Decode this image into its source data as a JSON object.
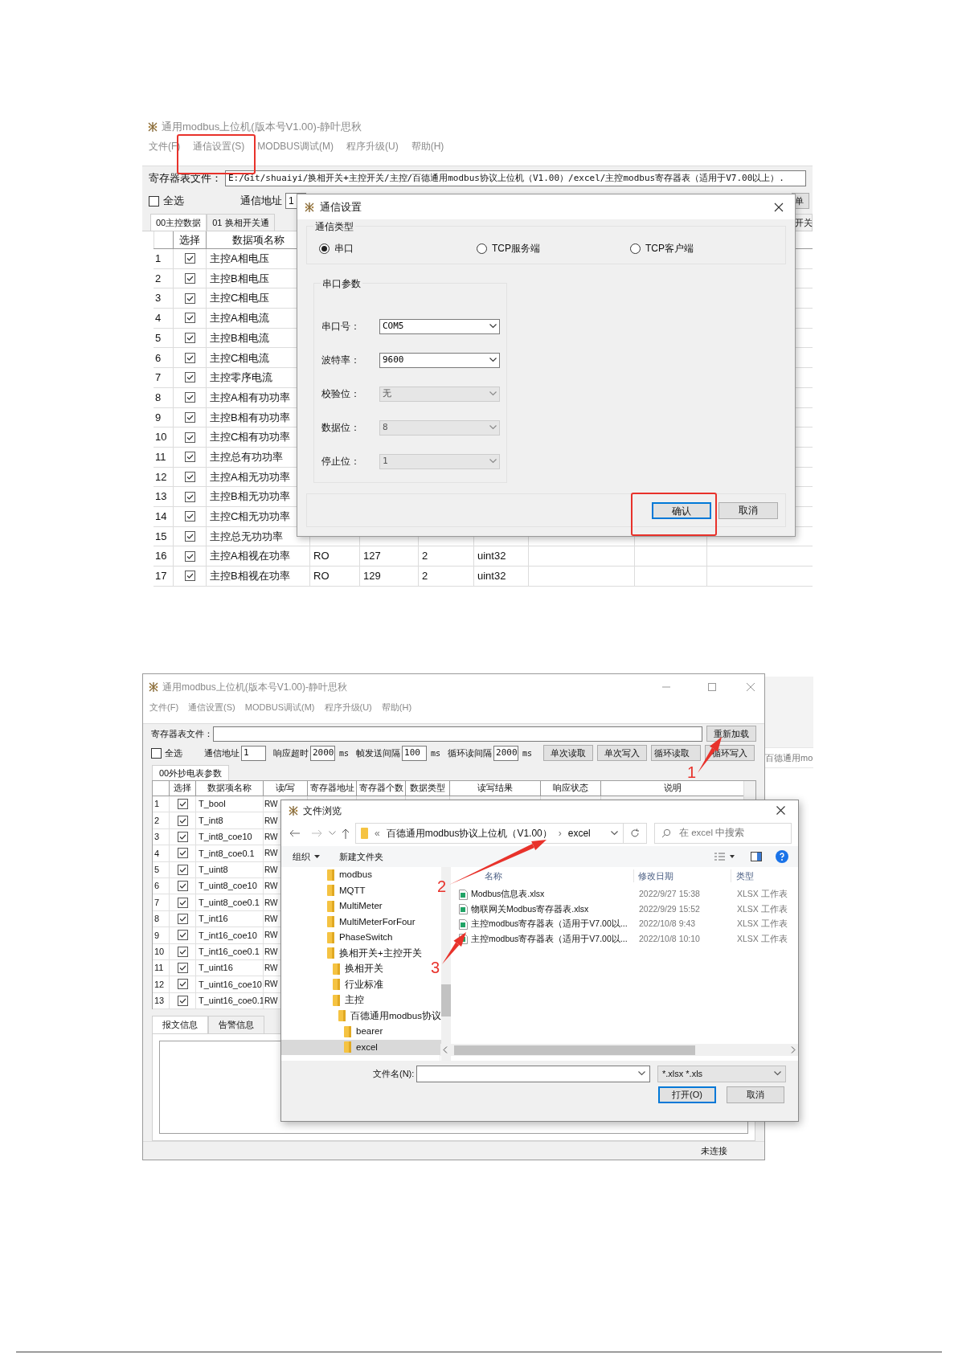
{
  "settings_view": {
    "window": {
      "title": "通用modbus上位机(版本号V1.00)-静叶思秋"
    },
    "menu": [
      "文件(F)",
      "通信设置(S)",
      "MODBUS调试(M)",
      "程序升级(U)",
      "帮助(H)"
    ],
    "register_file": {
      "label": "寄存器表文件：",
      "value": "E:/Git/shuaiyi/换相开关+主控开关/主控/百德通用modbus协议上位机（V1.00）/excel/主控modbus寄存器表（适用于V7.00以上）."
    },
    "select_all": {
      "label": "全选",
      "checked": false
    },
    "address": {
      "label": "通信地址",
      "value": "1"
    },
    "edge_button": "单",
    "tabs": [
      {
        "label": "00主控数据",
        "selected": true
      },
      {
        "label": "01 换相开关通",
        "selected": false
      },
      {
        "label": "开关",
        "selected": false
      }
    ],
    "table": {
      "columns": [
        "选择",
        "数据项名称"
      ],
      "rows": [
        {
          "index": "1",
          "checked": true,
          "name": "主控A相电压"
        },
        {
          "index": "2",
          "checked": true,
          "name": "主控B相电压"
        },
        {
          "index": "3",
          "checked": true,
          "name": "主控C相电压"
        },
        {
          "index": "4",
          "checked": true,
          "name": "主控A相电流"
        },
        {
          "index": "5",
          "checked": true,
          "name": "主控B相电流"
        },
        {
          "index": "6",
          "checked": true,
          "name": "主控C相电流"
        },
        {
          "index": "7",
          "checked": true,
          "name": "主控零序电流"
        },
        {
          "index": "8",
          "checked": true,
          "name": "主控A相有功功率"
        },
        {
          "index": "9",
          "checked": true,
          "name": "主控B相有功功率"
        },
        {
          "index": "10",
          "checked": true,
          "name": "主控C相有功功率"
        },
        {
          "index": "11",
          "checked": true,
          "name": "主控总有功功率"
        },
        {
          "index": "12",
          "checked": true,
          "name": "主控A相无功功率"
        },
        {
          "index": "13",
          "checked": true,
          "name": "主控B相无功功率"
        },
        {
          "index": "14",
          "checked": true,
          "name": "主控C相无功功率"
        },
        {
          "index": "15",
          "checked": true,
          "name": "主控总无功功率"
        },
        {
          "index": "16",
          "checked": true,
          "name": "主控A相视在功率",
          "cells": [
            "RO",
            "127",
            "2",
            "uint32"
          ]
        },
        {
          "index": "17",
          "checked": true,
          "name": "主控B相视在功率",
          "cells": [
            "RO",
            "129",
            "2",
            "uint32"
          ]
        }
      ]
    },
    "dialog": {
      "title": "通信设置",
      "type_group": {
        "title": "通信类型",
        "options": [
          {
            "label": "串口",
            "selected": true
          },
          {
            "label": "TCP服务端",
            "selected": false
          },
          {
            "label": "TCP客户端",
            "selected": false
          }
        ]
      },
      "serial_group": {
        "title": "串口参数",
        "fields": [
          {
            "label": "串口号：",
            "value": "COM5",
            "disabled": false
          },
          {
            "label": "波特率：",
            "value": "9600",
            "disabled": false
          },
          {
            "label": "校验位：",
            "value": "无",
            "disabled": true
          },
          {
            "label": "数据位：",
            "value": "8",
            "disabled": true
          },
          {
            "label": "停止位：",
            "value": "1",
            "disabled": true
          }
        ]
      },
      "buttons": [
        {
          "label": "确认",
          "default": true
        },
        {
          "label": "取消",
          "default": false
        }
      ]
    }
  },
  "file_view": {
    "window": {
      "title": "通用modbus上位机(版本号V1.00)-静叶思秋"
    },
    "menu": [
      "文件(F)",
      "通信设置(S)",
      "MODBUS调试(M)",
      "程序升级(U)",
      "帮助(H)"
    ],
    "register_file": {
      "label": "寄存器表文件："
    },
    "reload_button": "重新加载",
    "select_all": {
      "label": "全选",
      "checked": false
    },
    "params": [
      {
        "label": "通信地址",
        "value": "1"
      },
      {
        "label": "响应超时",
        "value": "2000",
        "unit": "ms"
      },
      {
        "label": "帧发送间隔",
        "value": "100",
        "unit": "ms"
      },
      {
        "label": "循环读间隔",
        "value": "2000",
        "unit": "ms"
      }
    ],
    "action_buttons": [
      "单次读取",
      "单次写入",
      "循环读取",
      "循环写入"
    ],
    "tabs": [
      {
        "label": "00外抄电表参数",
        "selected": true
      }
    ],
    "table": {
      "columns": [
        "选择",
        "数据项名称",
        "读/写",
        "寄存器地址",
        "寄存器个数",
        "数据类型",
        "读写结果",
        "响应状态",
        "说明"
      ],
      "rows": [
        {
          "index": "1",
          "checked": true,
          "name": "T_bool",
          "rw": "RW"
        },
        {
          "index": "2",
          "checked": true,
          "name": "T_int8",
          "rw": "RW"
        },
        {
          "index": "3",
          "checked": true,
          "name": "T_int8_coe10",
          "rw": "RW"
        },
        {
          "index": "4",
          "checked": true,
          "name": "T_int8_coe0.1",
          "rw": "RW"
        },
        {
          "index": "5",
          "checked": true,
          "name": "T_uint8",
          "rw": "RW"
        },
        {
          "index": "6",
          "checked": true,
          "name": "T_uint8_coe10",
          "rw": "RW"
        },
        {
          "index": "7",
          "checked": true,
          "name": "T_uint8_coe0.1",
          "rw": "RW"
        },
        {
          "index": "8",
          "checked": true,
          "name": "T_int16",
          "rw": "RW"
        },
        {
          "index": "9",
          "checked": true,
          "name": "T_int16_coe10",
          "rw": "RW"
        },
        {
          "index": "10",
          "checked": true,
          "name": "T_int16_coe0.1",
          "rw": "RW"
        },
        {
          "index": "11",
          "checked": true,
          "name": "T_uint16",
          "rw": "RW"
        },
        {
          "index": "12",
          "checked": true,
          "name": "T_uint16_coe10",
          "rw": "RW"
        },
        {
          "index": "13",
          "checked": true,
          "name": "T_uint16_coe0.1",
          "rw": "RW"
        }
      ]
    },
    "bottom_tabs": [
      {
        "label": "报文信息",
        "selected": true
      },
      {
        "label": "告警信息",
        "selected": false
      }
    ],
    "status": "未连接",
    "behind_window_text": "百德通用mo",
    "file_dialog": {
      "title": "文件浏览",
      "breadcrumb": {
        "prefix": "«",
        "parent": "百德通用modbus协议上位机（V1.00）",
        "separator": "›",
        "current": "excel"
      },
      "search_placeholder": "在 excel 中搜索",
      "toolbar": [
        "组织",
        "新建文件夹"
      ],
      "tree": [
        {
          "label": "modbus",
          "selected": false
        },
        {
          "label": "MQTT",
          "selected": false
        },
        {
          "label": "MultiMeter",
          "selected": false
        },
        {
          "label": "MultiMeterForFour",
          "selected": false
        },
        {
          "label": "PhaseSwitch",
          "selected": false
        },
        {
          "label": "换相开关+主控开关",
          "selected": false,
          "children": [
            {
              "label": "换相开关",
              "selected": false
            },
            {
              "label": "行业标准",
              "selected": false
            },
            {
              "label": "主控",
              "selected": false,
              "children": [
                {
                  "label": "百德通用modbus协议",
                  "selected": false,
                  "children": [
                    {
                      "label": "bearer",
                      "selected": false
                    },
                    {
                      "label": "excel",
                      "selected": true
                    }
                  ]
                }
              ]
            }
          ]
        }
      ],
      "columns": [
        "名称",
        "修改日期",
        "类型"
      ],
      "files": [
        {
          "name": "Modbus信息表.xlsx",
          "date": "2022/9/27 15:38",
          "type": "XLSX 工作表"
        },
        {
          "name": "物联网关Modbus寄存器表.xlsx",
          "date": "2022/9/29 15:52",
          "type": "XLSX 工作表"
        },
        {
          "name": "主控modbus寄存器表（适用于V7.00以...",
          "date": "2022/10/8 9:43",
          "type": "XLSX 工作表"
        },
        {
          "name": "主控modbus寄存器表（适用于V7.00以...",
          "date": "2022/10/8 10:10",
          "type": "XLSX 工作表"
        }
      ],
      "filename_label": "文件名(N):",
      "filter": "*.xlsx *.xls",
      "buttons": [
        {
          "label": "打开(O)",
          "default": true
        },
        {
          "label": "取消",
          "default": false
        }
      ]
    },
    "callouts": [
      {
        "label": "1"
      },
      {
        "label": "2"
      },
      {
        "label": "3"
      }
    ]
  }
}
